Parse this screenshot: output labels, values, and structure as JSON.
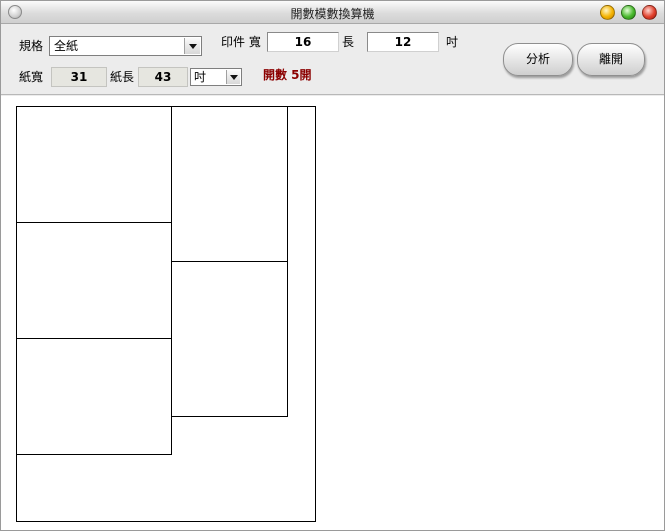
{
  "window": {
    "title": "開數模數換算機"
  },
  "form": {
    "spec_label": "規格",
    "spec_value": "全紙",
    "print_label": "印件 寬",
    "print_width": "16",
    "length_label": "長",
    "print_length": "12",
    "print_unit": "吋",
    "paper_width_label": "紙寬",
    "paper_width": "31",
    "paper_length_label": "紙長",
    "paper_length": "43",
    "paper_unit": "吋",
    "count_text": "開數  5開"
  },
  "buttons": {
    "analyze": "分析",
    "leave": "離開"
  },
  "layout_plan": {
    "sheet": {
      "width": 31,
      "height": 43
    },
    "pieces": [
      {
        "x": 0,
        "y": 0,
        "w": 16,
        "h": 12
      },
      {
        "x": 0,
        "y": 12,
        "w": 16,
        "h": 12
      },
      {
        "x": 0,
        "y": 24,
        "w": 16,
        "h": 12
      },
      {
        "x": 16,
        "y": 0,
        "w": 12,
        "h": 16
      },
      {
        "x": 16,
        "y": 16,
        "w": 12,
        "h": 16
      }
    ]
  }
}
